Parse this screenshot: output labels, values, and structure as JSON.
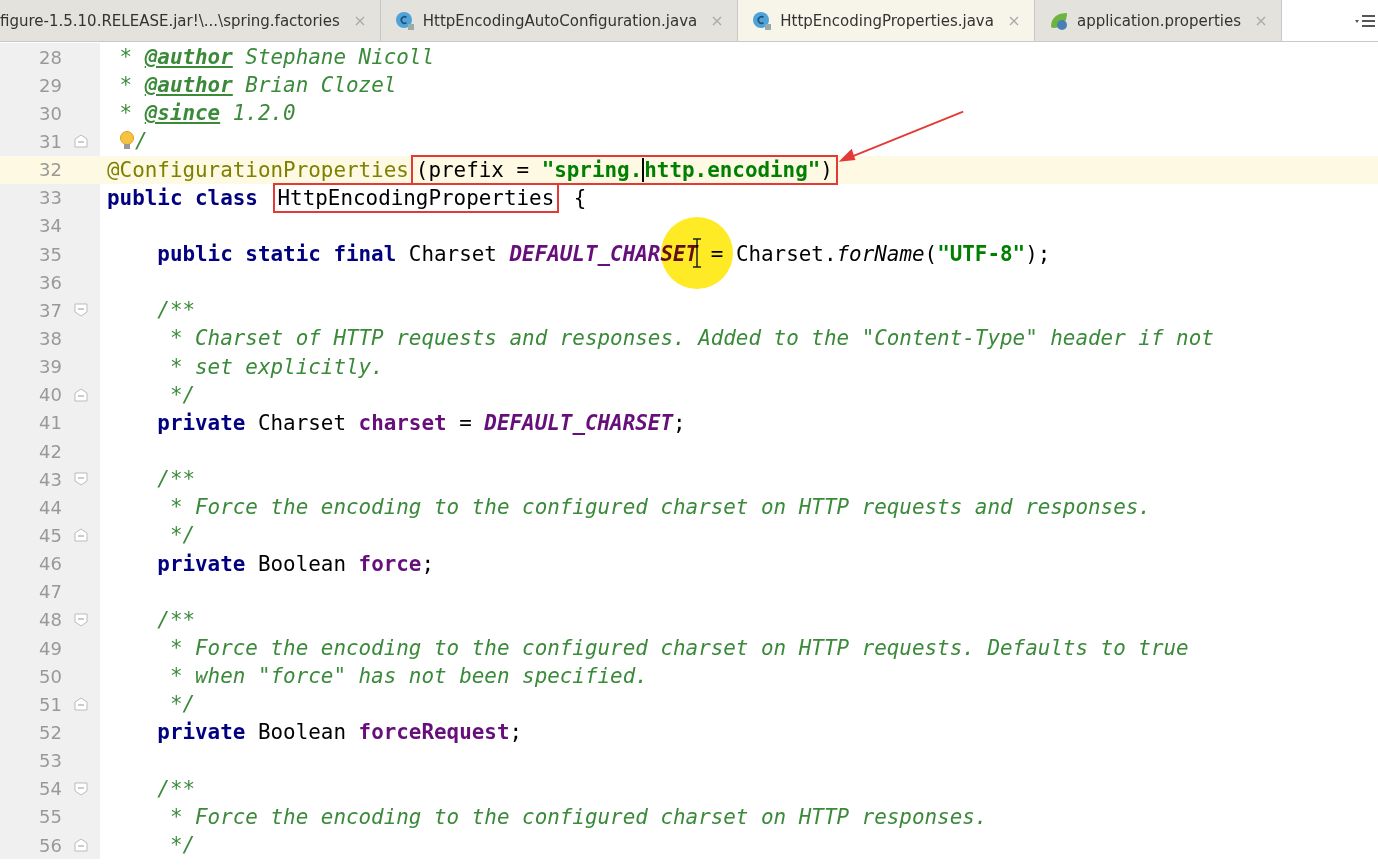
{
  "tabs": [
    {
      "label": "figure-1.5.10.RELEASE.jar!\\...\\spring.factories",
      "kind": "text",
      "selected": false
    },
    {
      "label": "HttpEncodingAutoConfiguration.java",
      "kind": "class",
      "selected": false
    },
    {
      "label": "HttpEncodingProperties.java",
      "kind": "class",
      "selected": true
    },
    {
      "label": "application.properties",
      "kind": "spring",
      "selected": false
    }
  ],
  "lines": [
    {
      "number": "28",
      "tokens": [
        {
          "kind": "comment",
          "text": " * "
        },
        {
          "kind": "tag",
          "text": "@author"
        },
        {
          "kind": "comment",
          "text": " Stephane Nicoll"
        }
      ]
    },
    {
      "number": "29",
      "tokens": [
        {
          "kind": "comment",
          "text": " * "
        },
        {
          "kind": "tag",
          "text": "@author"
        },
        {
          "kind": "comment",
          "text": " Brian Clozel"
        }
      ]
    },
    {
      "number": "30",
      "tokens": [
        {
          "kind": "comment",
          "text": " * "
        },
        {
          "kind": "tag",
          "text": "@since"
        },
        {
          "kind": "comment",
          "text": " 1.2.0"
        }
      ]
    },
    {
      "number": "31",
      "fold_end": true,
      "bulb": true,
      "tokens": [
        {
          "kind": "comment",
          "text": "/"
        }
      ]
    },
    {
      "number": "32",
      "current": true,
      "tokens": [
        {
          "kind": "annotation",
          "text": "@ConfigurationProperties"
        },
        {
          "kind": "plain",
          "text": "(prefix = ",
          "boxed": true
        },
        {
          "kind": "string",
          "text": "\"spring.",
          "boxed": true
        },
        {
          "kind": "caret",
          "boxed": true
        },
        {
          "kind": "string",
          "text": "http.encoding\"",
          "boxed": true
        },
        {
          "kind": "plain",
          "text": ")",
          "boxed": true
        }
      ]
    },
    {
      "number": "33",
      "tokens": [
        {
          "kind": "keyword",
          "text": "public class "
        },
        {
          "kind": "plain",
          "text": "HttpEncodingProperties",
          "boxed": true
        },
        {
          "kind": "plain",
          "text": " {"
        }
      ]
    },
    {
      "number": "34"
    },
    {
      "number": "35",
      "tokens": [
        {
          "kind": "keyword",
          "text": "    public static final"
        },
        {
          "kind": "plain",
          "text": " Charset "
        },
        {
          "kind": "constant",
          "text": "DEFAULT_CHARSET"
        },
        {
          "kind": "plain",
          "text": " = Charset."
        },
        {
          "kind": "italic",
          "text": "forName"
        },
        {
          "kind": "plain",
          "text": "("
        },
        {
          "kind": "string",
          "text": "\"UTF-8\""
        },
        {
          "kind": "plain",
          "text": ");"
        }
      ]
    },
    {
      "number": "36"
    },
    {
      "number": "37",
      "fold_start": true,
      "tokens": [
        {
          "kind": "comment",
          "text": "    /**"
        }
      ]
    },
    {
      "number": "38",
      "tokens": [
        {
          "kind": "comment",
          "text": "     * Charset of HTTP requests and responses. Added to the \"Content-Type\" header if not"
        }
      ]
    },
    {
      "number": "39",
      "tokens": [
        {
          "kind": "comment",
          "text": "     * set explicitly."
        }
      ]
    },
    {
      "number": "40",
      "fold_end": true,
      "tokens": [
        {
          "kind": "comment",
          "text": "     */"
        }
      ]
    },
    {
      "number": "41",
      "tokens": [
        {
          "kind": "keyword",
          "text": "    private"
        },
        {
          "kind": "plain",
          "text": " Charset "
        },
        {
          "kind": "field",
          "text": "charset"
        },
        {
          "kind": "plain",
          "text": " = "
        },
        {
          "kind": "constant",
          "text": "DEFAULT_CHARSET"
        },
        {
          "kind": "plain",
          "text": ";"
        }
      ]
    },
    {
      "number": "42"
    },
    {
      "number": "43",
      "fold_start": true,
      "tokens": [
        {
          "kind": "comment",
          "text": "    /**"
        }
      ]
    },
    {
      "number": "44",
      "tokens": [
        {
          "kind": "comment",
          "text": "     * Force the encoding to the configured charset on HTTP requests and responses."
        }
      ]
    },
    {
      "number": "45",
      "fold_end": true,
      "tokens": [
        {
          "kind": "comment",
          "text": "     */"
        }
      ]
    },
    {
      "number": "46",
      "tokens": [
        {
          "kind": "keyword",
          "text": "    private"
        },
        {
          "kind": "plain",
          "text": " Boolean "
        },
        {
          "kind": "field",
          "text": "force"
        },
        {
          "kind": "plain",
          "text": ";"
        }
      ]
    },
    {
      "number": "47"
    },
    {
      "number": "48",
      "fold_start": true,
      "tokens": [
        {
          "kind": "comment",
          "text": "    /**"
        }
      ]
    },
    {
      "number": "49",
      "tokens": [
        {
          "kind": "comment",
          "text": "     * Force the encoding to the configured charset on HTTP requests. Defaults to true"
        }
      ]
    },
    {
      "number": "50",
      "tokens": [
        {
          "kind": "comment",
          "text": "     * when \"force\" has not been specified."
        }
      ]
    },
    {
      "number": "51",
      "fold_end": true,
      "tokens": [
        {
          "kind": "comment",
          "text": "     */"
        }
      ]
    },
    {
      "number": "52",
      "tokens": [
        {
          "kind": "keyword",
          "text": "    private"
        },
        {
          "kind": "plain",
          "text": " Boolean "
        },
        {
          "kind": "field",
          "text": "forceRequest"
        },
        {
          "kind": "plain",
          "text": ";"
        }
      ]
    },
    {
      "number": "53"
    },
    {
      "number": "54",
      "fold_start": true,
      "tokens": [
        {
          "kind": "comment",
          "text": "    /**"
        }
      ]
    },
    {
      "number": "55",
      "tokens": [
        {
          "kind": "comment",
          "text": "     * Force the encoding to the configured charset on HTTP responses."
        }
      ]
    },
    {
      "number": "56",
      "fold_end": true,
      "tokens": [
        {
          "kind": "comment",
          "text": "     */"
        }
      ]
    }
  ]
}
